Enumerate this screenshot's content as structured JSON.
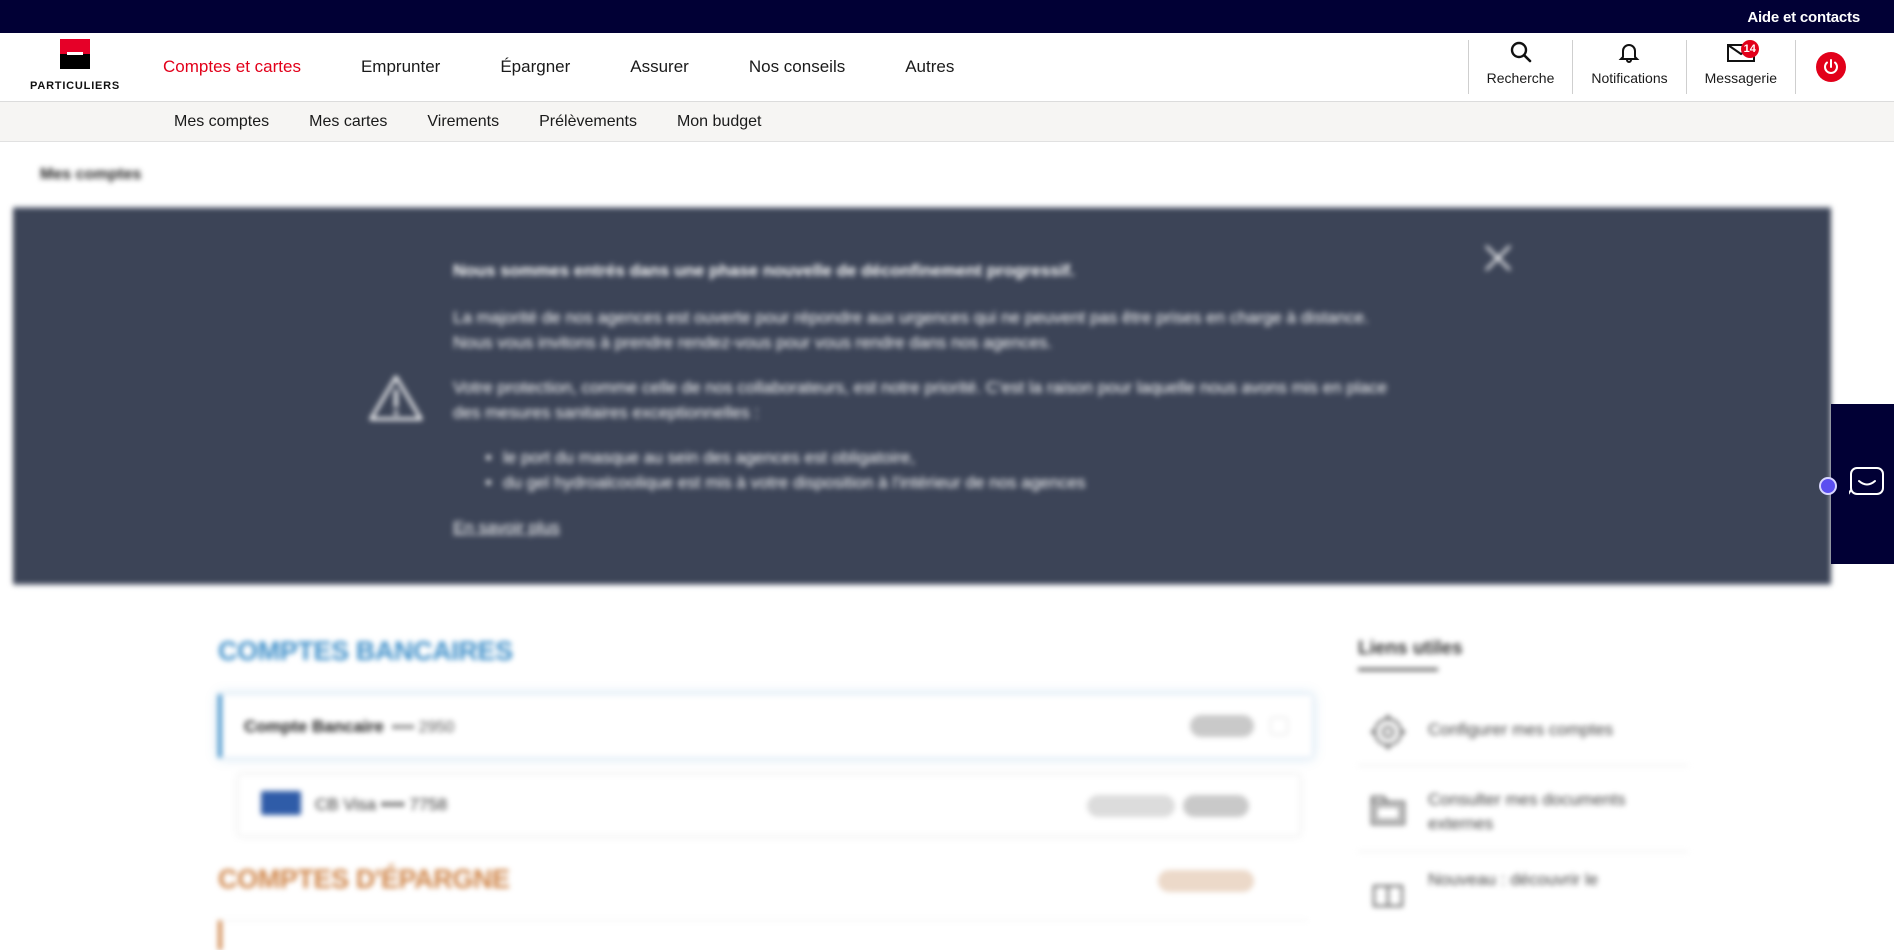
{
  "topbar": {
    "help_label": "Aide et contacts"
  },
  "logo": {
    "text": "PARTICULIERS"
  },
  "main_nav": [
    {
      "label": "Comptes et cartes",
      "active": true
    },
    {
      "label": "Emprunter",
      "active": false
    },
    {
      "label": "Épargner",
      "active": false
    },
    {
      "label": "Assurer",
      "active": false
    },
    {
      "label": "Nos conseils",
      "active": false
    },
    {
      "label": "Autres",
      "active": false
    }
  ],
  "tools": {
    "search_label": "Recherche",
    "notifications_label": "Notifications",
    "messages_label": "Messagerie",
    "messages_badge": "14"
  },
  "sub_nav": [
    "Mes comptes",
    "Mes cartes",
    "Virements",
    "Prélèvements",
    "Mon budget"
  ],
  "breadcrumb": "Mes comptes",
  "banner": {
    "title": "Nous sommes entrés dans une phase nouvelle de déconfinement progressif.",
    "paragraph1": "La majorité de nos agences est ouverte pour répondre aux urgences qui ne peuvent pas être prises en charge à distance. Nous vous invitons à prendre rendez-vous pour vous rendre dans nos agences.",
    "paragraph2": "Votre protection, comme celle de nos collaborateurs, est notre priorité. C'est la raison pour laquelle nous avons mis en place des mesures sanitaires exceptionnelles :",
    "bullets": [
      "le port du masque au sein des agences est obligatoire,",
      "du gel hydroalcoolique est mis à votre disposition à l'intérieur de nos agences"
    ],
    "link": "En savoir plus"
  },
  "accounts": {
    "bank_title": "COMPTES BANCAIRES",
    "account_name": "Compte Bancaire",
    "account_number": "•••• 2950",
    "card_name": "CB Visa •••• 7758",
    "savings_title": "COMPTES D'ÉPARGNE"
  },
  "useful_links": {
    "title": "Liens utiles",
    "items": [
      "Configurer mes comptes",
      "Consulter mes documents externes",
      "Nouveau : découvrir le"
    ]
  },
  "colors": {
    "brand_red": "#e2001a",
    "top_strip": "#010035",
    "banner_bg": "#3c4457",
    "bank_blue": "#3e8fc9",
    "savings_orange": "#cf8549"
  }
}
